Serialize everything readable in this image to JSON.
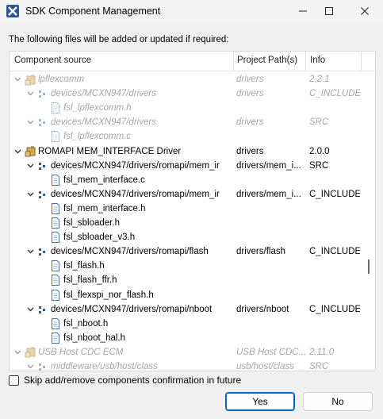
{
  "window": {
    "title": "SDK Component Management"
  },
  "intro": "The following files will be added or updated if required:",
  "columns": {
    "source": "Component source",
    "path": "Project Path(s)",
    "info": "Info"
  },
  "rows": [
    {
      "label": "lpflexcomm",
      "path": "drivers",
      "info": "2.2.1",
      "level": 0,
      "kind": "component",
      "dim": true
    },
    {
      "label": "devices/MCXN947/drivers",
      "path": "drivers",
      "info": "C_INCLUDE",
      "level": 1,
      "kind": "folder",
      "dim": true
    },
    {
      "label": "fsl_lpflexcomm.h",
      "path": "",
      "info": "",
      "level": 2,
      "kind": "file",
      "dim": true
    },
    {
      "label": "devices/MCXN947/drivers",
      "path": "drivers",
      "info": "SRC",
      "level": 1,
      "kind": "folder",
      "dim": true
    },
    {
      "label": "fsl_lpflexcomm.c",
      "path": "",
      "info": "",
      "level": 2,
      "kind": "file",
      "dim": true
    },
    {
      "label": "ROMAPI MEM_INTERFACE Driver",
      "path": "drivers",
      "info": "2.0.0",
      "level": 0,
      "kind": "component",
      "dim": false
    },
    {
      "label": "devices/MCXN947/drivers/romapi/mem_ir",
      "path": "drivers/mem_i...",
      "info": "SRC",
      "level": 1,
      "kind": "folder",
      "dim": false
    },
    {
      "label": "fsl_mem_interface.c",
      "path": "",
      "info": "",
      "level": 2,
      "kind": "file",
      "dim": false
    },
    {
      "label": "devices/MCXN947/drivers/romapi/mem_ir",
      "path": "drivers/mem_i...",
      "info": "C_INCLUDE",
      "level": 1,
      "kind": "folder",
      "dim": false
    },
    {
      "label": "fsl_mem_interface.h",
      "path": "",
      "info": "",
      "level": 2,
      "kind": "file",
      "dim": false
    },
    {
      "label": "fsl_sbloader.h",
      "path": "",
      "info": "",
      "level": 2,
      "kind": "file",
      "dim": false
    },
    {
      "label": "fsl_sbloader_v3.h",
      "path": "",
      "info": "",
      "level": 2,
      "kind": "file",
      "dim": false
    },
    {
      "label": "devices/MCXN947/drivers/romapi/flash",
      "path": "drivers/flash",
      "info": "C_INCLUDE",
      "level": 1,
      "kind": "folder",
      "dim": false
    },
    {
      "label": "fsl_flash.h",
      "path": "",
      "info": "",
      "level": 2,
      "kind": "file",
      "dim": false
    },
    {
      "label": "fsl_flash_ffr.h",
      "path": "",
      "info": "",
      "level": 2,
      "kind": "file",
      "dim": false
    },
    {
      "label": "fsl_flexspi_nor_flash.h",
      "path": "",
      "info": "",
      "level": 2,
      "kind": "file",
      "dim": false
    },
    {
      "label": "devices/MCXN947/drivers/romapi/nboot",
      "path": "drivers/nboot",
      "info": "C_INCLUDE",
      "level": 1,
      "kind": "folder",
      "dim": false
    },
    {
      "label": "fsl_nboot.h",
      "path": "",
      "info": "",
      "level": 2,
      "kind": "file",
      "dim": false
    },
    {
      "label": "fsl_nboot_hal.h",
      "path": "",
      "info": "",
      "level": 2,
      "kind": "file",
      "dim": false
    },
    {
      "label": "USB Host CDC ECM",
      "path": "USB Host CDC...",
      "info": "2.11.0",
      "level": 0,
      "kind": "component",
      "dim": true
    },
    {
      "label": "middleware/usb/host/class",
      "path": "usb/host/class",
      "info": "SRC",
      "level": 1,
      "kind": "folder",
      "dim": true
    }
  ],
  "footer": {
    "checkbox_label": "Skip add/remove components confirmation in future",
    "yes_label": "Yes",
    "no_label": "No"
  }
}
